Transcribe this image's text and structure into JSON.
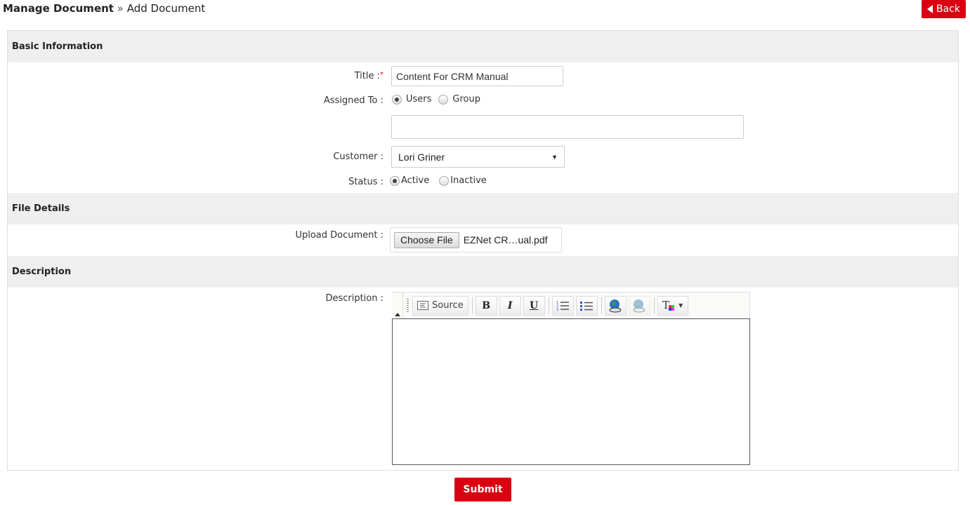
{
  "breadcrumb": {
    "parent": "Manage Document",
    "separator": "»",
    "current": "Add Document"
  },
  "header": {
    "back_label": "Back"
  },
  "sections": {
    "basic": "Basic Information",
    "file": "File Details",
    "description": "Description"
  },
  "form": {
    "title_label": "Title :",
    "title_required_mark": "*",
    "title_value": "Content For CRM Manual",
    "assigned_label": "Assigned To :",
    "assigned_options": [
      "Users",
      "Group"
    ],
    "assigned_selected": "Users",
    "assignee_value": "",
    "customer_label": "Customer :",
    "customer_value": "Lori Griner",
    "status_label": "Status :",
    "status_options": [
      "Active",
      "Inactive"
    ],
    "status_selected": "Active",
    "upload_label": "Upload Document :",
    "choose_file_label": "Choose File",
    "file_name": "EZNet CR…ual.pdf",
    "description_label": "Description :",
    "description_value": ""
  },
  "editor_toolbar": {
    "source_label": "Source",
    "bold": "B",
    "italic": "I",
    "underline": "U"
  },
  "actions": {
    "submit_label": "Submit"
  },
  "colors": {
    "accent": "#d90012",
    "section_bg": "#efefef"
  }
}
